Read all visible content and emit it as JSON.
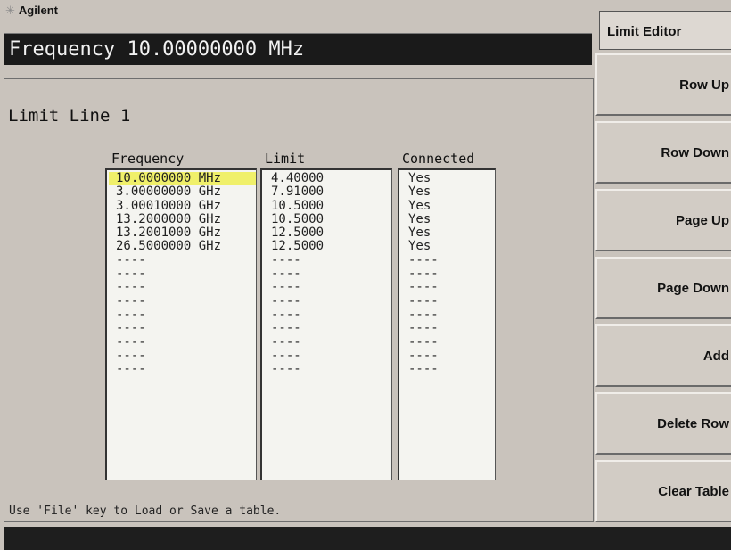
{
  "header": {
    "brand": "Agilent",
    "frequency_readout": "Frequency 10.00000000 MHz"
  },
  "table": {
    "title": "Limit Line 1",
    "columns": [
      "Frequency",
      "Limit",
      "Connected"
    ],
    "rows": [
      [
        "10.0000000 MHz",
        "4.40000",
        "Yes"
      ],
      [
        "3.00000000 GHz",
        "7.91000",
        "Yes"
      ],
      [
        "3.00010000 GHz",
        "10.5000",
        "Yes"
      ],
      [
        "13.2000000 GHz",
        "10.5000",
        "Yes"
      ],
      [
        "13.2001000 GHz",
        "12.5000",
        "Yes"
      ],
      [
        "26.5000000 GHz",
        "12.5000",
        "Yes"
      ],
      [
        "----",
        "----",
        "----"
      ],
      [
        "----",
        "----",
        "----"
      ],
      [
        "----",
        "----",
        "----"
      ],
      [
        "----",
        "----",
        "----"
      ],
      [
        "----",
        "----",
        "----"
      ],
      [
        "----",
        "----",
        "----"
      ],
      [
        "----",
        "----",
        "----"
      ],
      [
        "----",
        "----",
        "----"
      ],
      [
        "----",
        "----",
        "----"
      ]
    ],
    "hint": "Use 'File' key to Load or Save a table."
  },
  "softkeys": {
    "menu_title": "Limit Editor",
    "keys": [
      "Row Up",
      "Row Down",
      "Page Up",
      "Page Down",
      "Add",
      "Delete Row",
      "Clear Table"
    ]
  },
  "colors": {
    "background": "#c9c3bc",
    "selected_cell": "#f0f06a",
    "readout_bar": "#1a1a1a"
  }
}
